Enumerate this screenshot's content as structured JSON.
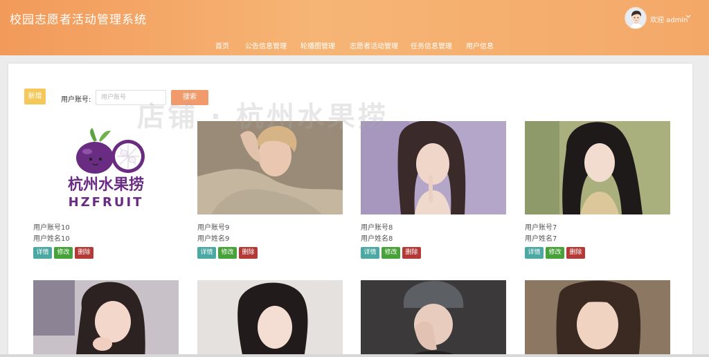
{
  "header": {
    "title": "校园志愿者活动管理系统",
    "nav": [
      "首页",
      "公告信息管理",
      "轮播图管理",
      "志愿者活动管理",
      "任务信息管理",
      "用户信息"
    ],
    "welcome": "欢迎 admin"
  },
  "toolbar": {
    "add_label": "新增",
    "search_label": "用户账号:",
    "search_placeholder": "用户账号",
    "search_button": "搜索"
  },
  "watermark": {
    "text": "店铺 · 杭州水果捞",
    "logo_cn": "杭州水果捞",
    "logo_en": "HZFRUIT"
  },
  "cards": [
    {
      "account": "用户账号10",
      "name": "用户姓名10",
      "photo": "logo"
    },
    {
      "account": "用户账号9",
      "name": "用户姓名9",
      "photo": "portrait"
    },
    {
      "account": "用户账号8",
      "name": "用户姓名8",
      "photo": "portrait"
    },
    {
      "account": "用户账号7",
      "name": "用户姓名7",
      "photo": "portrait"
    },
    {
      "photo": "portrait"
    },
    {
      "photo": "portrait"
    },
    {
      "photo": "portrait"
    },
    {
      "photo": "portrait"
    }
  ],
  "card_buttons": {
    "detail": "详情",
    "edit": "修改",
    "delete": "删除"
  },
  "colors": {
    "header_gradient_start": "#f29a5a",
    "header_gradient_end": "#f4a868",
    "add_button": "#f4c85b",
    "search_button": "#f19a6c",
    "detail_button": "#4ba8a2",
    "edit_button": "#48a23a",
    "delete_button": "#b33a36",
    "logo_purple": "#6a2b83"
  }
}
